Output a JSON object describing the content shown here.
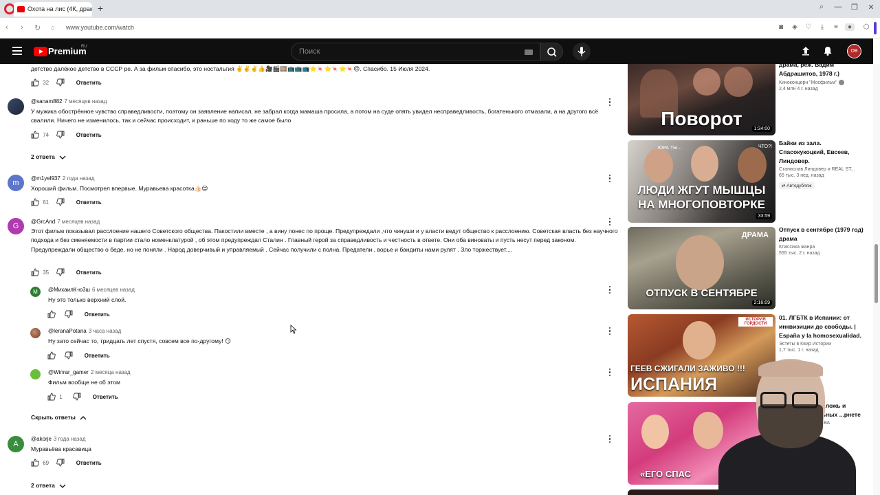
{
  "browser": {
    "tab_title": "Охота на лис (4К, драма",
    "new_tab": "+",
    "url": "www.youtube.com/watch"
  },
  "header": {
    "brand": "Premium",
    "region": "RU",
    "search_placeholder": "Поиск",
    "avatar_initials": "ОВ"
  },
  "comments": [
    {
      "text": "детство далёкое детство в СССР ре.  А за фильм спасибо, это ностальгия ✌️✌️✌️👍🎥🎬🎞️📺📺📺⭐🍬⭐🍬⭐🍬😌.  Спасибо. 15 Июля 2024.",
      "likes": "32",
      "reply_label": "Ответить"
    },
    {
      "author": "@sanam882",
      "time": "7 месяцев назад",
      "text": "У мужика обострённое чувство справедливости, поэтому он заявление написал, не забрал когда мамаша просила, а потом на суде опять увидел несправедливость, богатенького отмазали, а на другого всё свалили. Ничего не изменилось, так и сейчас происходит, и раньше по ходу то же самое было",
      "likes": "74",
      "reply_label": "Ответить",
      "replies_toggle": "2 ответа"
    },
    {
      "author": "@m1yel937",
      "time": "2 года назад",
      "avatar_letter": "m",
      "text": "Хороший фильм. Посмотрел впервые. Муравьева красотка👍🏻😌",
      "likes": "61",
      "reply_label": "Ответить"
    },
    {
      "author": "@GrcAnd",
      "time": "7 месяцев назад",
      "avatar_letter": "G",
      "text": "Этот фильм показывал расслоение нашего Советского общества. Пакостили вместе , а вину понес по проще. Предупреждали ,что чинуши и у власти ведут общество к расслоению. Советская власть без научного подхода и без сменяемости в партии стало номенклатурой , об этом предупреждал Сталин . Главный герой за справедливость и честность в ответе. Они оба виноваты и пусть несут перед законом. Предупреждали общество о беде, но не поняли . Народ доверчивый и управляемый . Сейчас получили с полна. Предатели , ворье и бандиты нами рулят . Зло торжествует....",
      "likes": "35",
      "reply_label": "Ответить"
    }
  ],
  "replies": [
    {
      "author": "@МихаилК-ю3ш",
      "time": "6 месяцев назад",
      "avatar_letter": "M",
      "text": "Ну это только верхний слой.",
      "likes": "",
      "reply_label": "Ответить"
    },
    {
      "author": "@leranaPotana",
      "time": "3 часа назад",
      "text": "Ну зато сейчас то, тридцать лет спустя, совсем все по-другому! 😏",
      "likes": "",
      "reply_label": "Ответить"
    },
    {
      "author": "@Winrar_gamer",
      "time": "2 месяца назад",
      "text": "Фильм вообще не об этом",
      "likes": "1",
      "reply_label": "Ответить"
    }
  ],
  "hide_replies": "Скрыть ответы",
  "last_comment": {
    "author": "@akorje",
    "time": "3 года назад",
    "avatar_letter": "A",
    "text": "Муравьёва красавица",
    "likes": "69",
    "reply_label": "Ответить",
    "replies_toggle": "2 ответа"
  },
  "sidebar": [
    {
      "thumb_text": "Поворот",
      "duration": "1:34:00",
      "title": "драма, реж. Вадим Абдрашитов, 1978 г.)",
      "channel": "Киноконцерн \"Мосфильм\"",
      "stats": "2,4 млн   4 г. назад"
    },
    {
      "thumb_text": "ЛЮДИ ЖГУТ МЫШЦЫ НА МНОГОПОВТОРКЕ",
      "thumb_top": "ЮРА ТЫ...",
      "thumb_top2": "ЧТО?!",
      "duration": "33:59",
      "title": "Байки из зала. Спасокукоцкий, Евсеев, Линдовер.",
      "channel": "Станислав Линдовер и REAL ST...",
      "stats": "65 тыс.   3 нед. назад",
      "badge": "Автодубляж"
    },
    {
      "thumb_text": "ОТПУСК В СЕНТЯБРЕ",
      "thumb_top": "ДРАМА",
      "duration": "2:16:09",
      "title": "Отпуск в сентябре (1979 год) драма",
      "channel": "Классика жанра",
      "stats": "555 тыс.   2 г. назад"
    },
    {
      "thumb_text": "ГЕЕВ СЖИГАЛИ ЗАЖИВО !!!",
      "thumb_text2": "ИСПАНИЯ",
      "thumb_top": "ИСТОРИЯ ГОРДОСТИ",
      "title": "01. ЛГБТК в Испании: от инквизиции до свободы. | España y la homosexualidad.",
      "channel": "Эстеты в Квир Истории",
      "stats": "1,7 тыс.   1 г. назад"
    },
    {
      "thumb_text": "«ЕГО СПАС",
      "title": "...ь: ложь и ...льных ...рнете",
      "channel": "...ЬЕВА"
    }
  ]
}
